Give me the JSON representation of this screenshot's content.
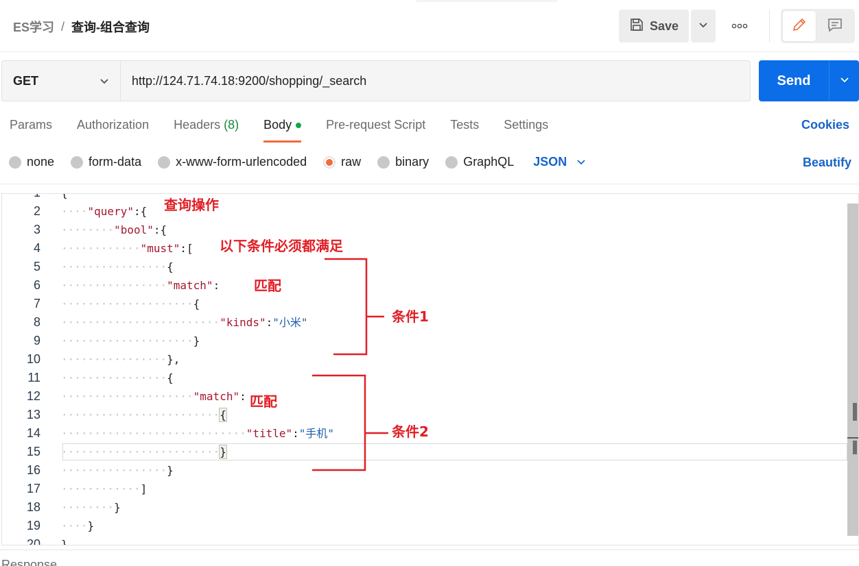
{
  "header": {
    "breadcrumb_parent": "ES学习",
    "breadcrumb_separator": "/",
    "breadcrumb_current": "查询-组合查询",
    "save_label": "Save"
  },
  "request": {
    "method": "GET",
    "url": "http://124.71.74.18:9200/shopping/_search",
    "send_label": "Send"
  },
  "tabs": [
    {
      "label": "Params"
    },
    {
      "label": "Authorization"
    },
    {
      "label": "Headers",
      "count": "(8)"
    },
    {
      "label": "Body",
      "active": true
    },
    {
      "label": "Pre-request Script"
    },
    {
      "label": "Tests"
    },
    {
      "label": "Settings"
    }
  ],
  "cookies_label": "Cookies",
  "body_types": [
    {
      "label": "none"
    },
    {
      "label": "form-data"
    },
    {
      "label": "x-www-form-urlencoded"
    },
    {
      "label": "raw",
      "selected": true
    },
    {
      "label": "binary"
    },
    {
      "label": "GraphQL"
    }
  ],
  "language": "JSON",
  "beautify_label": "Beautify",
  "editor": {
    "line_numbers": [
      "1",
      "2",
      "3",
      "4",
      "5",
      "6",
      "7",
      "8",
      "9",
      "10",
      "11",
      "12",
      "13",
      "14",
      "15",
      "16",
      "17",
      "18",
      "19",
      "20"
    ]
  },
  "annotations": {
    "query_op": "查询操作",
    "must_note": "以下条件必须都满足",
    "match1": "匹配",
    "match2": "匹配",
    "cond1": "条件1",
    "cond2": "条件2"
  },
  "response_label": "Response",
  "colors": {
    "accent_orange": "#f26b3a",
    "send_blue": "#0b6ee8",
    "link_blue": "#1864c8",
    "annotation_red": "#e01f26",
    "json_key": "#a3172d",
    "json_string": "#1f5fa8"
  }
}
